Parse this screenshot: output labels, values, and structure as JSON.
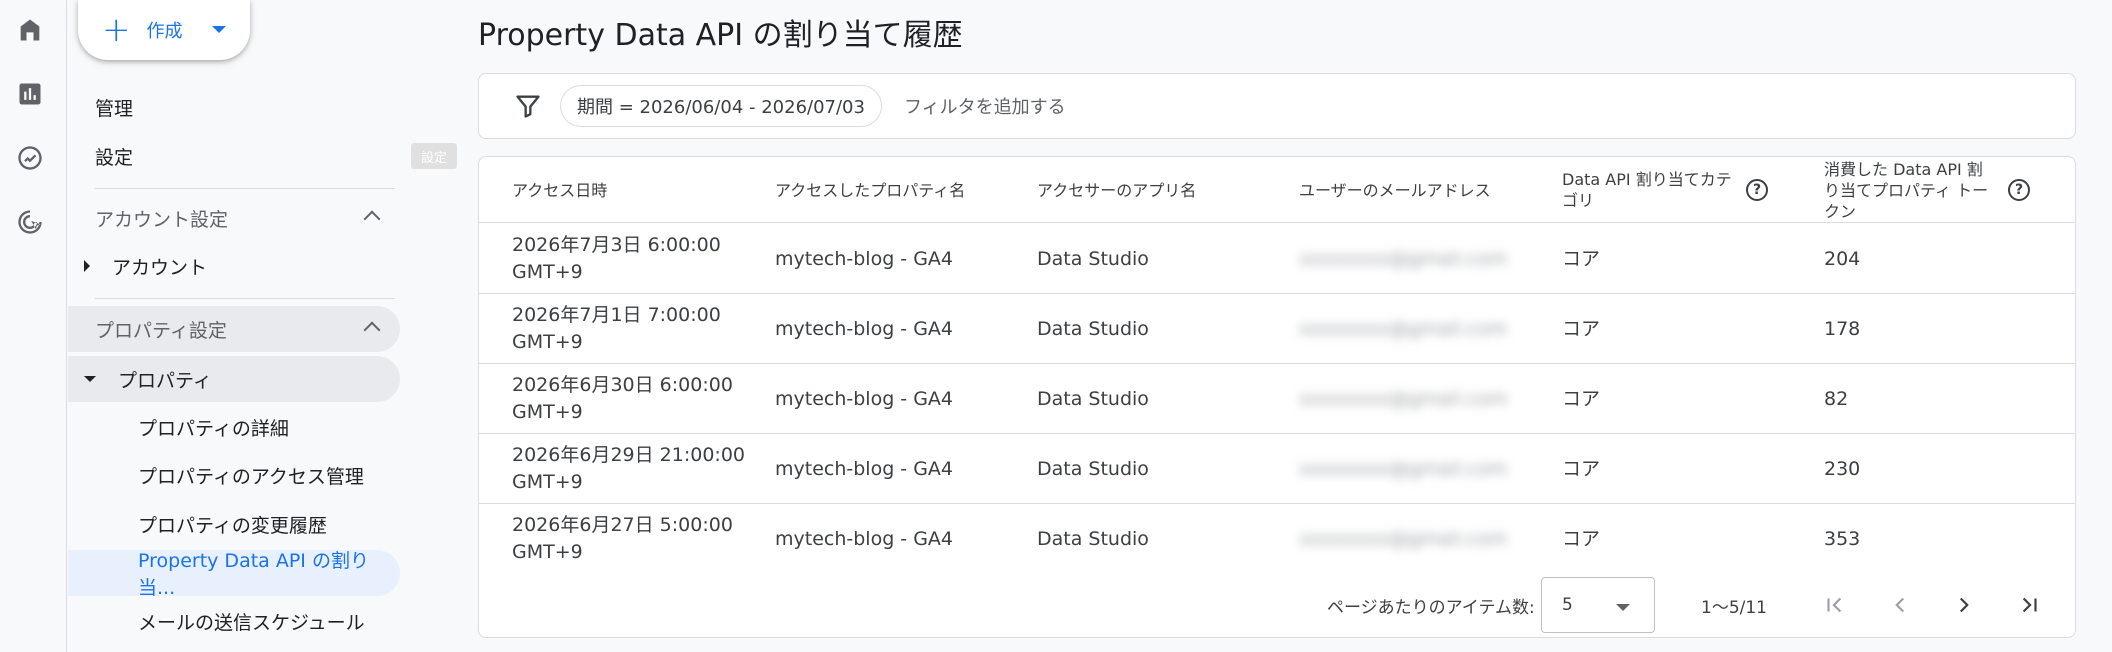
{
  "rail": {
    "icons": [
      "home-icon",
      "reports-icon",
      "explore-icon",
      "advertising-icon"
    ]
  },
  "sidebar": {
    "create_label": "作成",
    "admin_label": "管理",
    "settings_label": "設定",
    "settings_tooltip": "設定",
    "account_settings_label": "アカウント設定",
    "account_label": "アカウント",
    "property_settings_label": "プロパティ設定",
    "property_label": "プロパティ",
    "sub_items": [
      "プロパティの詳細",
      "プロパティのアクセス管理",
      "プロパティの変更履歴",
      "Property Data API の割り当...",
      "メールの送信スケジュール"
    ]
  },
  "main": {
    "title": "Property Data API の割り当て履歴",
    "filter_chip": "期間 = 2026/06/04 - 2026/07/03",
    "add_filter": "フィルタを追加する"
  },
  "table": {
    "headers": [
      "アクセス日時",
      "アクセスしたプロパティ名",
      "アクセサーのアプリ名",
      "ユーザーのメールアドレス",
      "Data API 割り当てカテゴリ",
      "消費した Data API 割り当てプロパティ トークン"
    ],
    "rows": [
      {
        "date": "2026年7月3日 6:00:00",
        "tz": "GMT+9",
        "property": "mytech-blog - GA4",
        "app": "Data Studio",
        "email": "xxxxxxxx@gmail.com",
        "category": "コア",
        "tokens": "204"
      },
      {
        "date": "2026年7月1日 7:00:00",
        "tz": "GMT+9",
        "property": "mytech-blog - GA4",
        "app": "Data Studio",
        "email": "xxxxxxxx@gmail.com",
        "category": "コア",
        "tokens": "178"
      },
      {
        "date": "2026年6月30日 6:00:00",
        "tz": "GMT+9",
        "property": "mytech-blog - GA4",
        "app": "Data Studio",
        "email": "xxxxxxxx@gmail.com",
        "category": "コア",
        "tokens": "82"
      },
      {
        "date": "2026年6月29日 21:00:00",
        "tz": "GMT+9",
        "property": "mytech-blog - GA4",
        "app": "Data Studio",
        "email": "xxxxxxxx@gmail.com",
        "category": "コア",
        "tokens": "230"
      },
      {
        "date": "2026年6月27日 5:00:00",
        "tz": "GMT+9",
        "property": "mytech-blog - GA4",
        "app": "Data Studio",
        "email": "xxxxxxxx@gmail.com",
        "category": "コア",
        "tokens": "353"
      }
    ]
  },
  "pager": {
    "items_per_page_label": "ページあたりのアイテム数:",
    "items_per_page_value": "5",
    "range": "1〜5/11"
  },
  "colors": {
    "accent": "#1a73e8",
    "selected_bg": "#e8f0fe",
    "section_bg": "#e8eaed"
  }
}
